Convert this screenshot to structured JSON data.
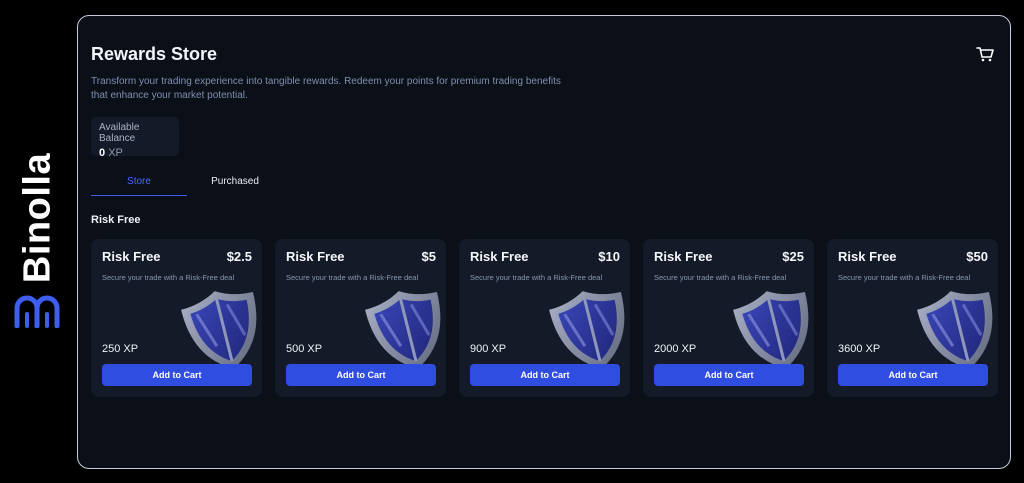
{
  "brand": {
    "name": "Binolla"
  },
  "page": {
    "title": "Rewards Store",
    "description": "Transform your trading experience into tangible rewards. Redeem your points for premium trading benefits that enhance your market potential."
  },
  "balance": {
    "label": "Available Balance",
    "value": "0",
    "unit": "XP"
  },
  "tabs": [
    {
      "label": "Store",
      "active": true
    },
    {
      "label": "Purchased",
      "active": false
    }
  ],
  "section": {
    "title": "Risk Free"
  },
  "cards": [
    {
      "title": "Risk Free",
      "price": "$2.5",
      "subtitle": "Secure your trade with a Risk-Free deal",
      "xp": "250 XP",
      "button": "Add to Cart"
    },
    {
      "title": "Risk Free",
      "price": "$5",
      "subtitle": "Secure your trade with a Risk-Free deal",
      "xp": "500 XP",
      "button": "Add to Cart"
    },
    {
      "title": "Risk Free",
      "price": "$10",
      "subtitle": "Secure your trade with a Risk-Free deal",
      "xp": "900 XP",
      "button": "Add to Cart"
    },
    {
      "title": "Risk Free",
      "price": "$25",
      "subtitle": "Secure your trade with a Risk-Free deal",
      "xp": "2000 XP",
      "button": "Add to Cart"
    },
    {
      "title": "Risk Free",
      "price": "$50",
      "subtitle": "Secure your trade with a Risk-Free deal",
      "xp": "3600 XP",
      "button": "Add to Cart"
    }
  ],
  "icons": {
    "cart": "cart-icon",
    "shield": "shield-icon",
    "logo": "binolla-logo-icon"
  },
  "colors": {
    "accent": "#2f4de0",
    "tab_active": "#4a6cf7",
    "panel_bg": "#0b0f18",
    "card_bg": "#141a27"
  }
}
